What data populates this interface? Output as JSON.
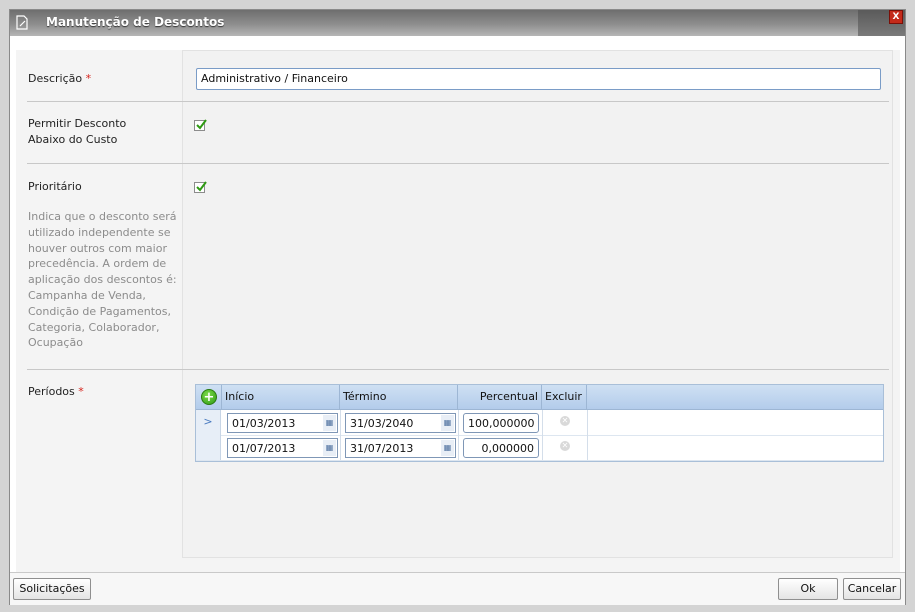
{
  "window": {
    "title": "Manutenção de Descontos",
    "close_label": "X"
  },
  "form": {
    "descricao_label": "Descrição",
    "descricao_value": "Administrativo / Financeiro",
    "required_mark": "*",
    "permitir_label_line1": "Permitir Desconto",
    "permitir_label_line2": "Abaixo do Custo",
    "permitir_checked": true,
    "prioritario_label": "Prioritário",
    "prioritario_checked": true,
    "prioritario_hint": "Indica que o desconto será utilizado independente se houver outros com maior precedência. A ordem de aplicação dos descontos é: Campanha de Venda, Condição de Pagamentos, Categoria, Colaborador, Ocupação",
    "periodos_label": "Períodos"
  },
  "periods_grid": {
    "columns": {
      "inicio": "Início",
      "termino": "Término",
      "percentual": "Percentual",
      "excluir": "Excluir"
    },
    "rows": [
      {
        "selected_marker": ">",
        "inicio": "01/03/2013",
        "termino": "31/03/2040",
        "percentual": "100,000000"
      },
      {
        "selected_marker": "",
        "inicio": "01/07/2013",
        "termino": "31/07/2013",
        "percentual": "0,000000"
      }
    ]
  },
  "footer": {
    "solicitacoes": "Solicitações",
    "ok": "Ok",
    "cancelar": "Cancelar"
  },
  "colors": {
    "required": "#d6221b",
    "check": "#2e9a12",
    "grid_header": "#c4d8ef"
  }
}
